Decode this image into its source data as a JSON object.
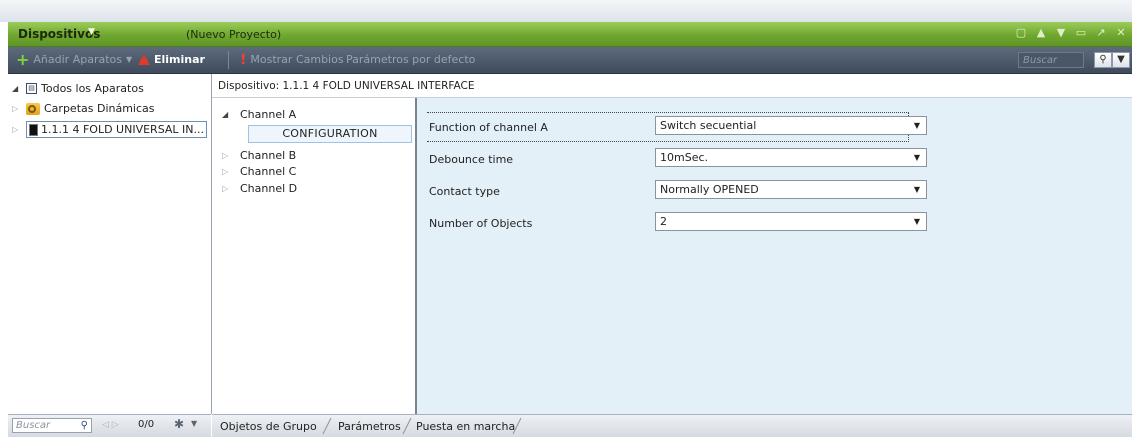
{
  "title": {
    "main": "Dispositivos",
    "project": "(Nuevo Proyecto)"
  },
  "toolbar": {
    "add_label": "Añadir Aparatos",
    "delete_label": "Eliminar",
    "changes_label": "Mostrar Cambios",
    "defaults_label": "Parámetros por defecto",
    "search_placeholder": "Buscar"
  },
  "tree": {
    "all_devices": "Todos los Aparatos",
    "dynamic_folders": "Carpetas Dinámicas",
    "device": "1.1.1  4 FOLD UNIVERSAL IN..."
  },
  "left_footer": {
    "search_placeholder": "Buscar",
    "count": "0/0"
  },
  "device_header": "Dispositivo: 1.1.1  4 FOLD UNIVERSAL INTERFACE",
  "channels": {
    "a": "Channel A",
    "config": "CONFIGURATION",
    "b": "Channel B",
    "c": "Channel C",
    "d": "Channel D"
  },
  "params": [
    {
      "label": "Function of channel A",
      "value": "Switch secuential"
    },
    {
      "label": "Debounce time",
      "value": "10mSec."
    },
    {
      "label": "Contact type",
      "value": "Normally OPENED"
    },
    {
      "label": "Number of Objects",
      "value": "2"
    }
  ],
  "tabs": [
    "Objetos de Grupo",
    "Parámetros",
    "Puesta en marcha"
  ]
}
